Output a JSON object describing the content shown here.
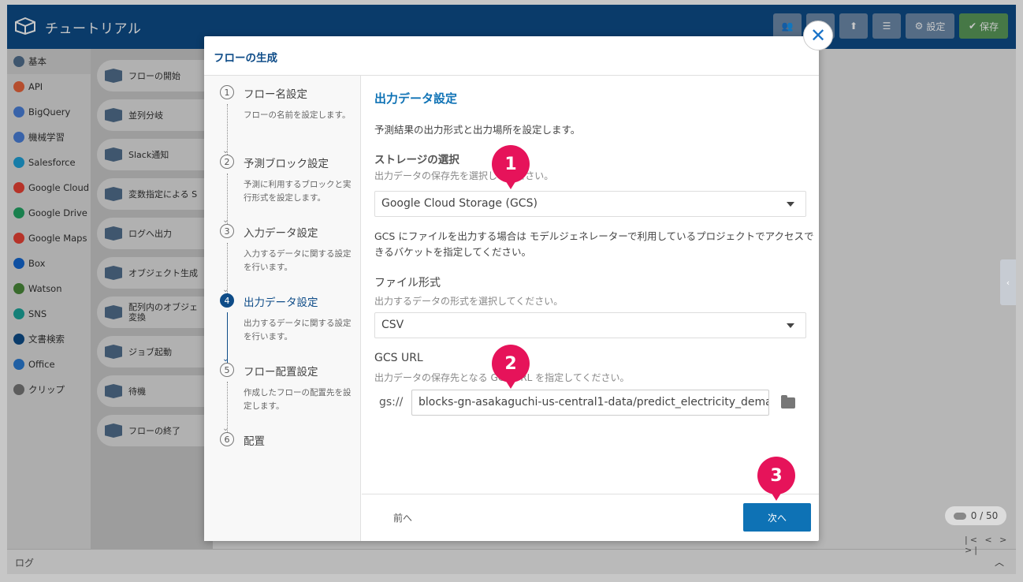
{
  "app": {
    "title": "チュートリアル",
    "toolbar": {
      "settings_label": "設定",
      "save_label": "保存"
    },
    "log_label": "ログ",
    "counter": "0 / 50",
    "pager": "|< < > >|"
  },
  "sidebar": {
    "items": [
      {
        "label": "基本",
        "icon": "blocks-icon",
        "color": "#516f8d"
      },
      {
        "label": "API",
        "icon": "api-icon",
        "color": "#e8643c"
      },
      {
        "label": "BigQuery",
        "icon": "bigquery-icon",
        "color": "#4a7fd9"
      },
      {
        "label": "機械学習",
        "icon": "ml-icon",
        "color": "#4a7fd9"
      },
      {
        "label": "Salesforce",
        "icon": "salesforce-icon",
        "color": "#1ea0d8"
      },
      {
        "label": "Google Cloud",
        "icon": "google-cloud-icon",
        "color": "#e94235"
      },
      {
        "label": "Google Drive",
        "icon": "google-drive-icon",
        "color": "#22a565"
      },
      {
        "label": "Google Maps",
        "icon": "google-maps-icon",
        "color": "#e94235"
      },
      {
        "label": "Box",
        "icon": "box-icon",
        "color": "#1467d0"
      },
      {
        "label": "Watson",
        "icon": "watson-icon",
        "color": "#4a8a3a"
      },
      {
        "label": "SNS",
        "icon": "sns-icon",
        "color": "#1aa59a"
      },
      {
        "label": "文書検索",
        "icon": "doc-search-icon",
        "color": "#0e4c88"
      },
      {
        "label": "Office",
        "icon": "office-icon",
        "color": "#2b7cd3"
      },
      {
        "label": "クリップ",
        "icon": "clip-icon",
        "color": "#777777"
      }
    ]
  },
  "palette": {
    "blocks": [
      "フローの開始",
      "並列分岐",
      "Slack通知",
      "変数指定による S",
      "ログへ出力",
      "オブジェクト生成",
      "配列内のオブジェ\n変換",
      "ジョブ起動",
      "待機",
      "フローの終了"
    ]
  },
  "modal": {
    "title": "フローの生成",
    "steps": [
      {
        "num": "1",
        "title": "フロー名設定",
        "desc": "フローの名前を設定します。"
      },
      {
        "num": "2",
        "title": "予測ブロック設定",
        "desc": "予測に利用するブロックと実行形式を設定します。"
      },
      {
        "num": "3",
        "title": "入力データ設定",
        "desc": "入力するデータに関する設定を行います。"
      },
      {
        "num": "4",
        "title": "出力データ設定",
        "desc": "出力するデータに関する設定を行います。"
      },
      {
        "num": "5",
        "title": "フロー配置設定",
        "desc": "作成したフローの配置先を設定します。"
      },
      {
        "num": "6",
        "title": "配置",
        "desc": ""
      }
    ],
    "content": {
      "title": "出力データ設定",
      "desc": "予測結果の出力形式と出力場所を設定します。",
      "storage_label": "ストレージの選択",
      "storage_hint": "出力データの保存先を選択してください。",
      "storage_value": "Google Cloud Storage (GCS)",
      "gcs_note": "GCS にファイルを出力する場合は モデルジェネレーターで利用しているプロジェクトでアクセスできるバケットを指定してください。",
      "format_label": "ファイル形式",
      "format_hint": "出力するデータの形式を選択してください。",
      "format_value": "CSV",
      "url_label": "GCS URL",
      "url_hint": "出力データの保存先となる GCS URL を指定してください。",
      "url_prefix": "gs://",
      "url_value": "blocks-gn-asakaguchi-us-central1-data/predict_electricity_dema"
    },
    "footer": {
      "prev_label": "前へ",
      "next_label": "次へ"
    }
  },
  "callouts": [
    "1",
    "2",
    "3"
  ],
  "colors": {
    "accent": "#0e72b5",
    "header": "#0e4c88",
    "callout": "#e6135a"
  }
}
